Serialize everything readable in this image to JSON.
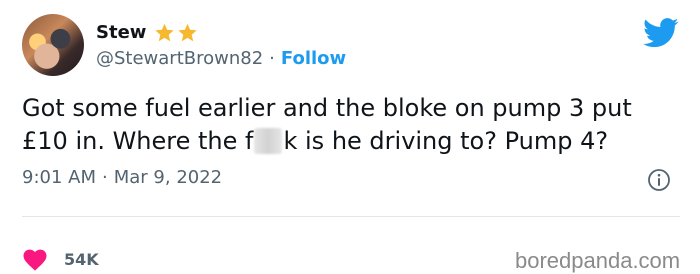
{
  "tweet": {
    "author": {
      "name": "Stew",
      "badges": [
        "star-icon",
        "star-icon"
      ],
      "handle": "@StewartBrown82",
      "separator": "·",
      "follow_label": "Follow"
    },
    "text": {
      "line1": "Got some fuel earlier and the bloke on pump 3 put",
      "line2_before": "£10 in. Where the f",
      "line2_after": "k is he driving to? Pump 4?"
    },
    "time": "9:01 AM",
    "meta_separator": "·",
    "date": "Mar 9, 2022",
    "likes": "54K"
  },
  "watermark": "boredpanda.com",
  "colors": {
    "accent": "#1d9bf0",
    "star": "#f5b82e",
    "heart": "#f91880",
    "muted_text": "#536471",
    "text": "#0f1419"
  },
  "icons": [
    "twitter-bird-icon",
    "info-icon",
    "heart-icon",
    "star-icon"
  ]
}
